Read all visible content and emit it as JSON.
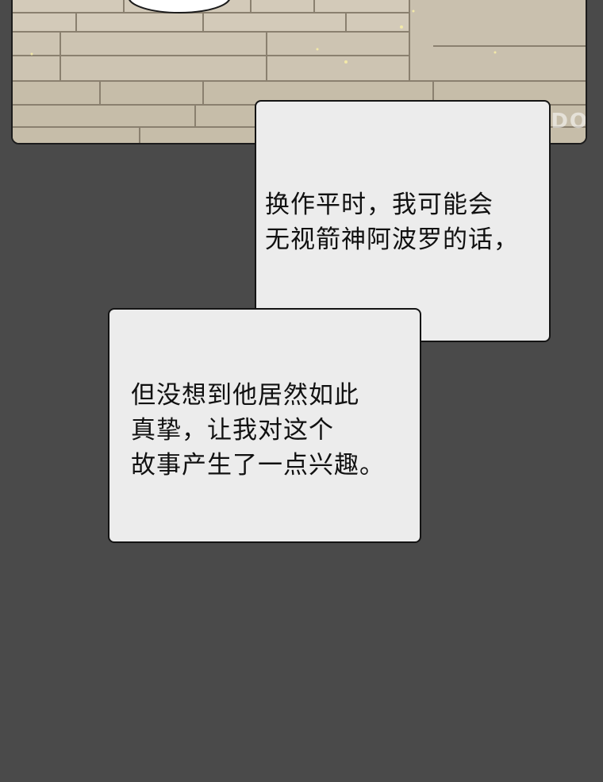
{
  "panel": {
    "watermark": "PODO"
  },
  "bubble_1": {
    "lines": [
      "换作平时，我可能会",
      "无视箭神阿波罗的话，"
    ]
  },
  "bubble_2": {
    "lines": [
      "但没想到他居然如此",
      "真挚，让我对这个",
      "故事产生了一点兴趣。"
    ]
  }
}
